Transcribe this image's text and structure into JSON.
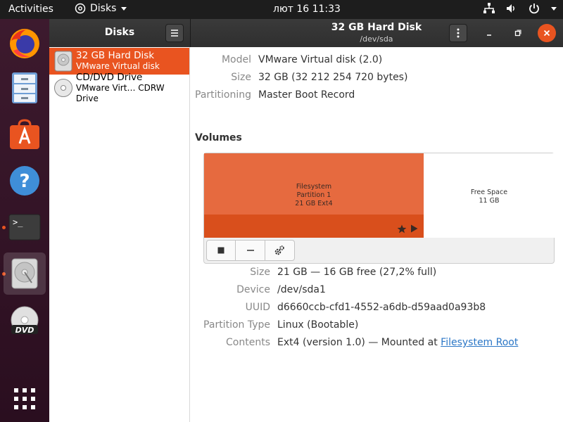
{
  "topbar": {
    "activities": "Activities",
    "app_name": "Disks",
    "clock": "лют 16  11:33"
  },
  "dock": {
    "items": [
      {
        "name": "firefox"
      },
      {
        "name": "files"
      },
      {
        "name": "software"
      },
      {
        "name": "help"
      },
      {
        "name": "terminal",
        "glyph": ">_"
      },
      {
        "name": "disks"
      },
      {
        "name": "dvd",
        "label": "DVD"
      }
    ]
  },
  "header": {
    "sidebar_title": "Disks",
    "title": "32 GB Hard Disk",
    "subtitle": "/dev/sda"
  },
  "sidebar": {
    "disks": [
      {
        "name": "32 GB Hard Disk",
        "desc": "VMware Virtual disk"
      },
      {
        "name": "CD/DVD Drive",
        "desc": "VMware Virt… CDRW Drive"
      }
    ]
  },
  "disk_info": {
    "model_label": "Model",
    "model": "VMware Virtual disk (2.0)",
    "size_label": "Size",
    "size": "32 GB (32 212 254 720 bytes)",
    "partitioning_label": "Partitioning",
    "partitioning": "Master Boot Record"
  },
  "volumes": {
    "title": "Volumes",
    "partition": {
      "line1": "Filesystem",
      "line2": "Partition 1",
      "line3": "21 GB Ext4"
    },
    "free": {
      "line1": "Free Space",
      "line2": "11 GB"
    }
  },
  "partition_info": {
    "size_label": "Size",
    "size": "21 GB — 16 GB free (27,2% full)",
    "device_label": "Device",
    "device": "/dev/sda1",
    "uuid_label": "UUID",
    "uuid": "d6660ccb-cfd1-4552-a6db-d59aad0a93b8",
    "type_label": "Partition Type",
    "type": "Linux (Bootable)",
    "contents_label": "Contents",
    "contents": "Ext4 (version 1.0) — Mounted at ",
    "contents_link": "Filesystem Root"
  },
  "colors": {
    "accent": "#e95420",
    "partition": "#e66a3f",
    "link": "#2a76c6"
  }
}
